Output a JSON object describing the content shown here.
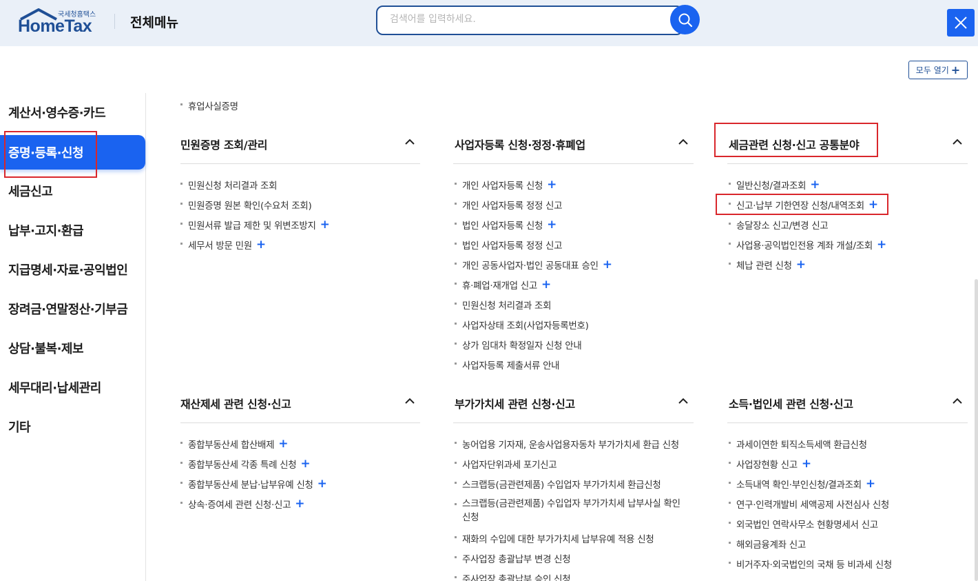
{
  "header": {
    "logo_small": "국세청홈택스",
    "logo_big": "HomeTax",
    "title": "전체메뉴",
    "search_placeholder": "검색어를 입력하세요."
  },
  "open_all_label": "모두 열기",
  "sidebar": {
    "items": [
      {
        "label": "계산서·영수증·카드"
      },
      {
        "label": "증명·등록·신청",
        "active": true
      },
      {
        "label": "세금신고"
      },
      {
        "label": "납부·고지·환급"
      },
      {
        "label": "지급명세·자료·공익법인"
      },
      {
        "label": "장려금·연말정산·기부금"
      },
      {
        "label": "상담·불복·제보"
      },
      {
        "label": "세무대리·납세관리"
      },
      {
        "label": "기타"
      }
    ]
  },
  "top_item": "휴업사실증명",
  "sections": [
    {
      "title": "민원증명 조회/관리",
      "items": [
        {
          "label": "민원신청 처리결과 조회",
          "plus": false
        },
        {
          "label": "민원증명 원본 확인(수요처 조회)",
          "plus": false
        },
        {
          "label": "민원서류 발급 제한 및 위변조방지",
          "plus": true
        },
        {
          "label": "세무서 방문 민원",
          "plus": true
        }
      ]
    },
    {
      "title": "사업자등록 신청·정정·휴폐업",
      "items": [
        {
          "label": "개인 사업자등록 신청",
          "plus": true
        },
        {
          "label": "개인 사업자등록 정정 신고",
          "plus": false
        },
        {
          "label": "법인 사업자등록 신청",
          "plus": true
        },
        {
          "label": "법인 사업자등록 정정 신고",
          "plus": false
        },
        {
          "label": "개인 공동사업자·법인 공동대표 승인",
          "plus": true
        },
        {
          "label": "휴·폐업·재개업 신고",
          "plus": true
        },
        {
          "label": "민원신청 처리결과 조회",
          "plus": false
        },
        {
          "label": "사업자상태 조회(사업자등록번호)",
          "plus": false
        },
        {
          "label": "상가 임대차 확정일자 신청 안내",
          "plus": false
        },
        {
          "label": "사업자등록 제출서류 안내",
          "plus": false
        }
      ]
    },
    {
      "title": "세금관련 신청·신고 공통분야",
      "items": [
        {
          "label": "일반신청/결과조회",
          "plus": true
        },
        {
          "label": "신고·납부 기한연장 신청/내역조회",
          "plus": true
        },
        {
          "label": "송달장소 신고/변경 신고",
          "plus": false
        },
        {
          "label": "사업용·공익법인전용 계좌 개설/조회",
          "plus": true
        },
        {
          "label": "체납 관련 신청",
          "plus": true
        }
      ]
    },
    {
      "title": "재산제세 관련 신청·신고",
      "items": [
        {
          "label": "종합부동산세 합산배제",
          "plus": true
        },
        {
          "label": "종합부동산세 각종 특례 신청",
          "plus": true
        },
        {
          "label": "종합부동산세 분납·납부유예 신청",
          "plus": true
        },
        {
          "label": "상속·증여세 관련 신청·신고",
          "plus": true
        }
      ]
    },
    {
      "title": "부가가치세 관련 신청·신고",
      "items": [
        {
          "label": "농어업용 기자재, 운송사업용자동차 부가가치세 환급 신청",
          "plus": false
        },
        {
          "label": "사업자단위과세 포기신고",
          "plus": false
        },
        {
          "label": "스크랩등(금관련제품) 수입업자 부가가치세 환급신청",
          "plus": false
        },
        {
          "label": "스크랩등(금관련제품) 수입업자 부가가치세 납부사실 확인신청",
          "plus": false
        },
        {
          "label": "재화의 수입에 대한 부가가치세 납부유예 적용 신청",
          "plus": false
        },
        {
          "label": "주사업장 총괄납부 변경 신청",
          "plus": false
        },
        {
          "label": "주사업장 총괄납부 승인 신청",
          "plus": false
        }
      ]
    },
    {
      "title": "소득·법인세 관련 신청·신고",
      "items": [
        {
          "label": "과세이연한 퇴직소득세액 환급신청",
          "plus": false
        },
        {
          "label": "사업장현황 신고",
          "plus": true
        },
        {
          "label": "소득내역 확인·부인신청/결과조회",
          "plus": true
        },
        {
          "label": "연구·인력개발비 세액공제 사전심사 신청",
          "plus": false
        },
        {
          "label": "외국법인 연락사무소 현황명세서 신고",
          "plus": false
        },
        {
          "label": "해외금융계좌 신고",
          "plus": false
        },
        {
          "label": "비거주자·외국법인의 국채 등 비과세 신청",
          "plus": false
        }
      ]
    }
  ]
}
